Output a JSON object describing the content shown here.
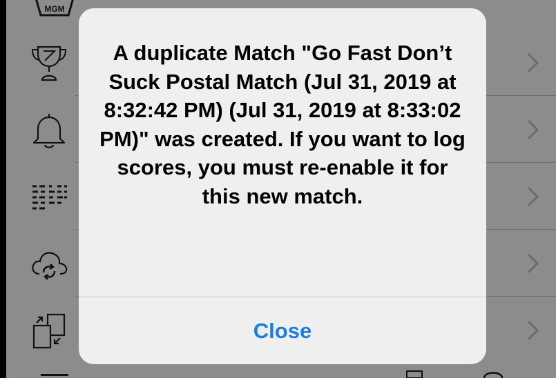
{
  "alert": {
    "message": "A duplicate Match \"Go Fast Don’t Suck Postal Match (Jul 31, 2019 at 8:32:42 PM) (Jul 31, 2019 at 8:33:02 PM)\" was created. If you want to log scores, you must re-enable it for this new match.",
    "close_label": "Close"
  },
  "menu": {
    "items": [
      {
        "icon": "trophy-icon"
      },
      {
        "icon": "bell-icon"
      },
      {
        "icon": "list-icon"
      },
      {
        "icon": "cloud-sync-icon"
      },
      {
        "icon": "copy-icon"
      }
    ]
  },
  "logo": {
    "text": "MGM"
  },
  "colors": {
    "dim_background": "#8c8c8c",
    "alert_background": "#efefef",
    "button_text": "#1b7fe0"
  }
}
